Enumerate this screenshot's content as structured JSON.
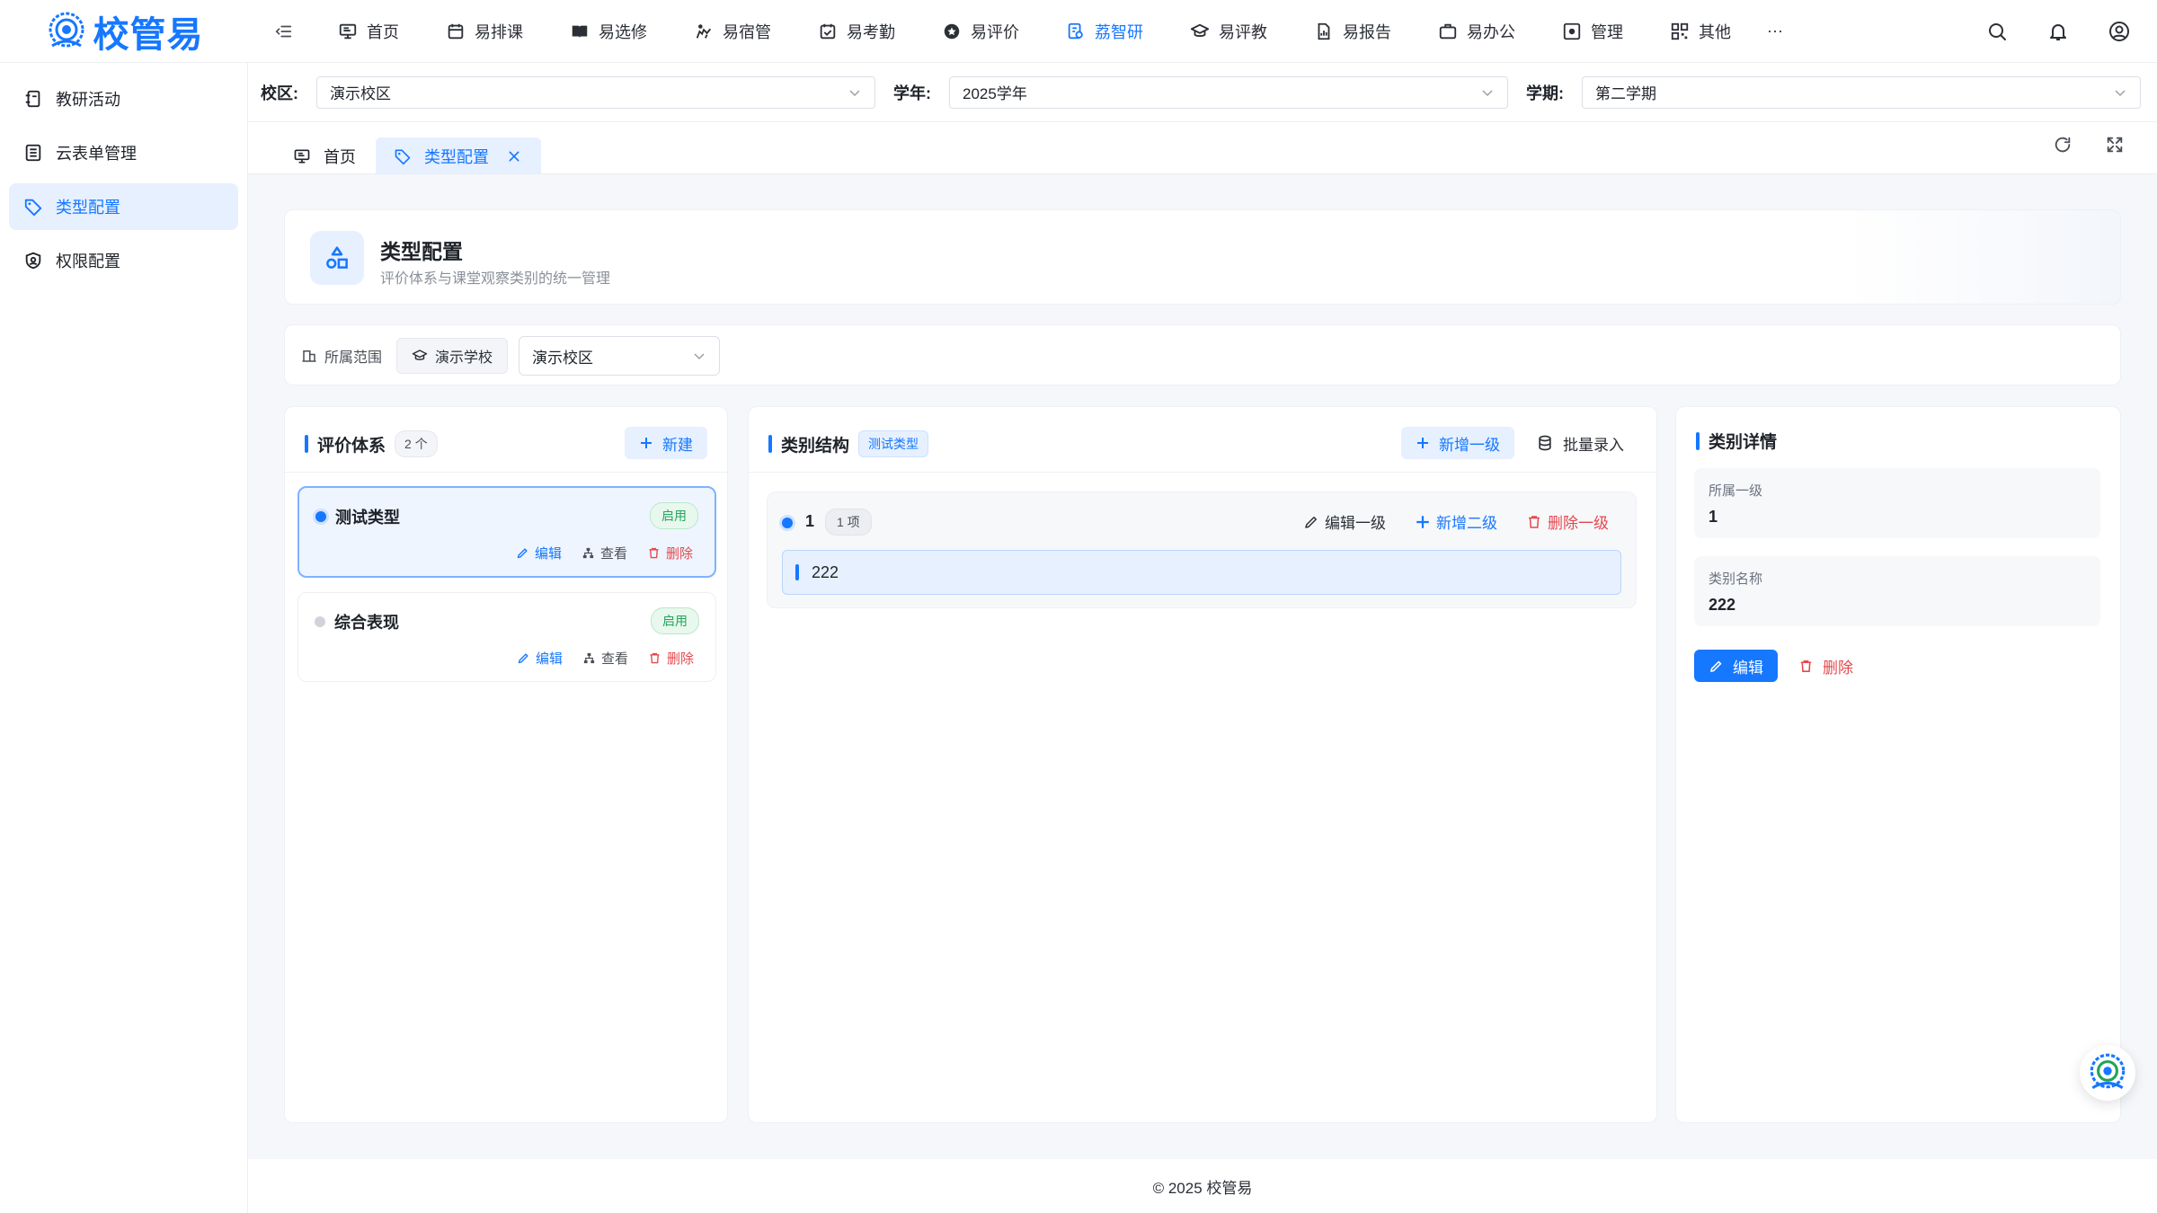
{
  "app": {
    "logo_text": "校管易"
  },
  "nav": {
    "items": [
      {
        "label": "首页",
        "icon": "monitor-icon"
      },
      {
        "label": "易排课",
        "icon": "calendar-icon"
      },
      {
        "label": "易选修",
        "icon": "book-icon"
      },
      {
        "label": "易宿管",
        "icon": "dorm-icon"
      },
      {
        "label": "易考勤",
        "icon": "calendar-check-icon"
      },
      {
        "label": "易评价",
        "icon": "star-icon"
      },
      {
        "label": "荔智研",
        "icon": "research-icon",
        "active": true
      },
      {
        "label": "易评教",
        "icon": "graduation-cap-icon"
      },
      {
        "label": "易报告",
        "icon": "report-icon"
      },
      {
        "label": "易办公",
        "icon": "briefcase-icon"
      },
      {
        "label": "管理",
        "icon": "gear-box-icon"
      },
      {
        "label": "其他",
        "icon": "grid-icon"
      }
    ],
    "more": "···"
  },
  "sidebar": {
    "items": [
      {
        "label": "教研活动",
        "icon": "activity-icon"
      },
      {
        "label": "云表单管理",
        "icon": "form-icon"
      },
      {
        "label": "类型配置",
        "icon": "tag-icon",
        "active": true
      },
      {
        "label": "权限配置",
        "icon": "shield-icon"
      }
    ]
  },
  "filters": {
    "campus_label": "校区:",
    "campus_value": "演示校区",
    "year_label": "学年:",
    "year_value": "2025学年",
    "term_label": "学期:",
    "term_value": "第二学期"
  },
  "tabs": [
    {
      "label": "首页"
    },
    {
      "label": "类型配置",
      "active": true
    }
  ],
  "page_header": {
    "title": "类型配置",
    "subtitle": "评价体系与课堂观察类别的统一管理"
  },
  "scope": {
    "label": "所属范围",
    "school": "演示学校",
    "campus_value": "演示校区"
  },
  "eval_panel": {
    "title": "评价体系",
    "count": "2 个",
    "new_label": "新建",
    "items": [
      {
        "name": "测试类型",
        "status": "启用",
        "edit": "编辑",
        "view": "查看",
        "delete": "删除"
      },
      {
        "name": "综合表现",
        "status": "启用",
        "edit": "编辑",
        "view": "查看",
        "delete": "删除"
      }
    ]
  },
  "structure_panel": {
    "title": "类别结构",
    "tag": "测试类型",
    "add_level1": "新增一级",
    "batch_import": "批量录入",
    "group": {
      "name": "1",
      "count": "1 项",
      "edit": "编辑一级",
      "add_level2": "新增二级",
      "delete": "删除一级",
      "children": [
        "222"
      ]
    }
  },
  "detail_panel": {
    "title": "类别详情",
    "parent_label": "所属一级",
    "parent_value": "1",
    "name_label": "类别名称",
    "name_value": "222",
    "edit": "编辑",
    "delete": "删除"
  },
  "footer": {
    "text": "© 2025 校管易"
  },
  "colors": {
    "primary": "#1677ff",
    "success": "#22a559",
    "danger": "#e5484d"
  }
}
